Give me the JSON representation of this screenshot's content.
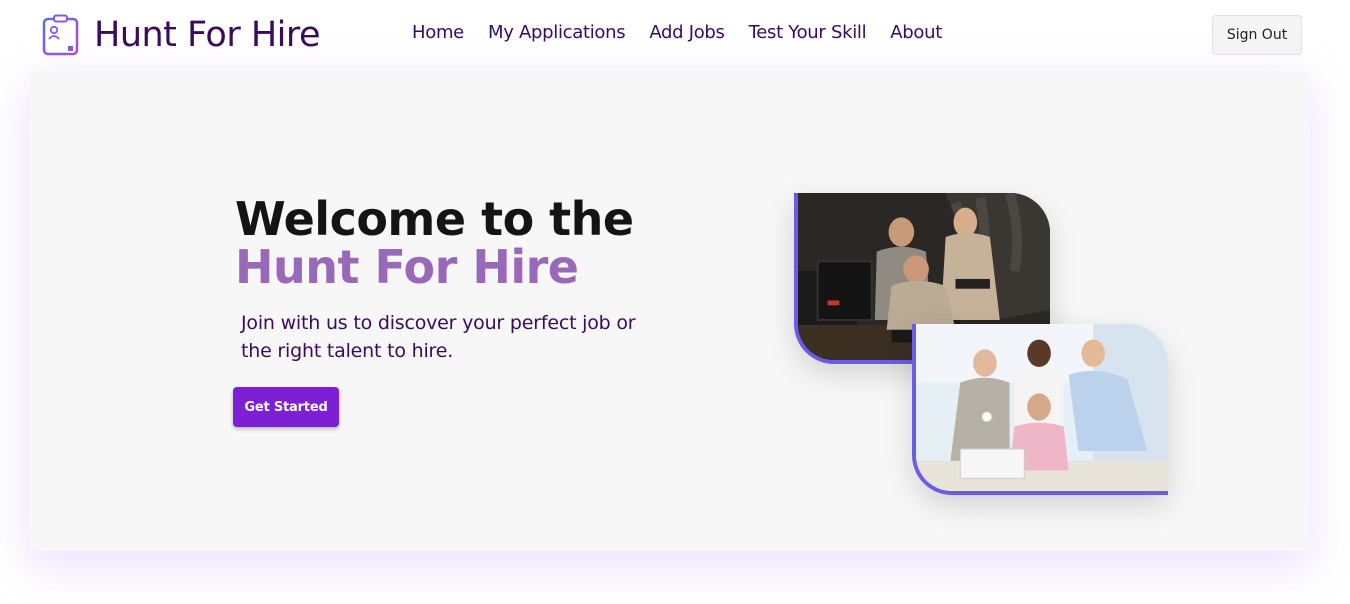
{
  "nav": {
    "brand": "Hunt For Hire",
    "links": [
      "Home",
      "My Applications",
      "Add Jobs",
      "Test Your Skill",
      "About"
    ],
    "signout_label": "Sign Out"
  },
  "hero": {
    "title_line1": "Welcome to the",
    "title_line2": "Hunt For Hire",
    "subtitle": "Join with us to discover your perfect job or the right talent to hire.",
    "cta_label": "Get Started"
  },
  "colors": {
    "brand": "#3b0a5c",
    "accent": "#9a68b8",
    "button": "#7d1fd4",
    "image_border": "#6a5ce8"
  }
}
